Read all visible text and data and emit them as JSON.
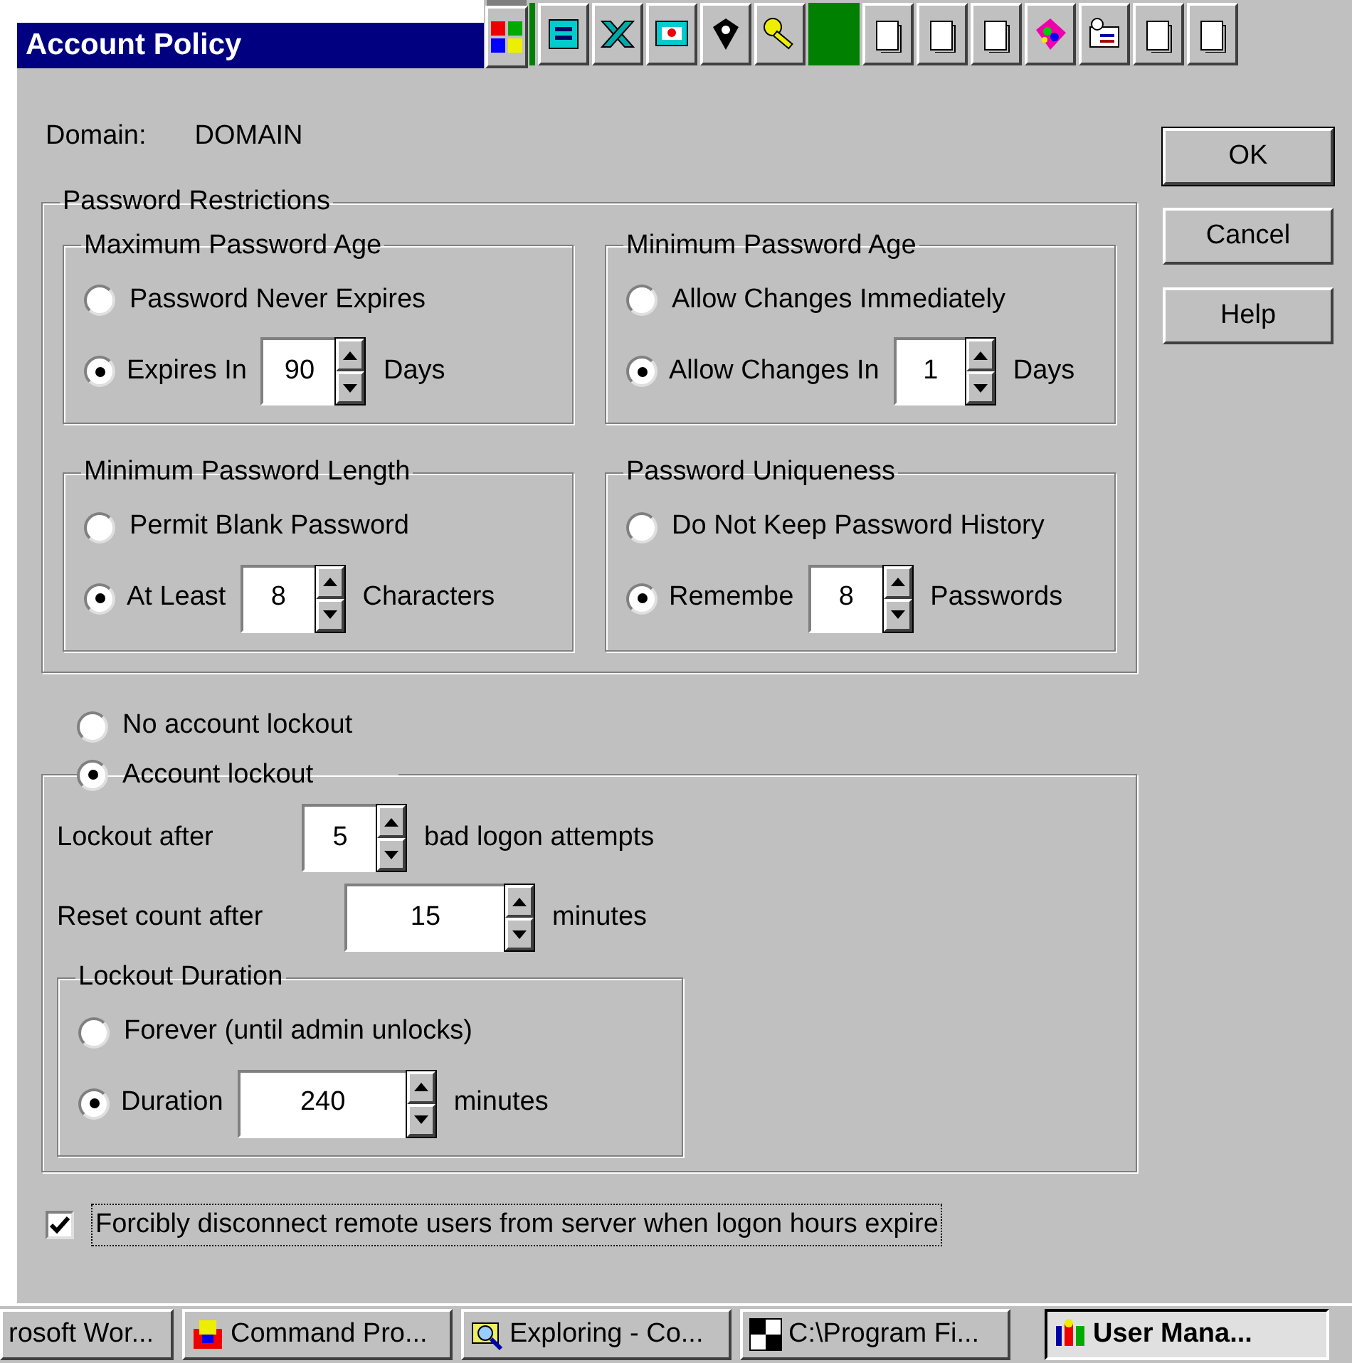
{
  "window": {
    "title": "Account Policy"
  },
  "domain": {
    "label": "Domain:",
    "value": "DOMAIN"
  },
  "buttons": [
    {
      "label": "OK",
      "default": true
    },
    {
      "label": "Cancel",
      "default": false
    },
    {
      "label": "Help",
      "default": false
    }
  ],
  "password_restrictions": {
    "title": "Password Restrictions",
    "groups": [
      {
        "title": "Maximum Password Age",
        "options": [
          {
            "kind": "radio",
            "label": "Password Never Expires",
            "selected": false
          },
          {
            "kind": "spin",
            "label": "Expires In",
            "selected": true,
            "value": "90",
            "unit": "Days"
          }
        ]
      },
      {
        "title": "Minimum Password Age",
        "options": [
          {
            "kind": "radio",
            "label": "Allow Changes Immediately",
            "selected": false
          },
          {
            "kind": "spin",
            "label": "Allow Changes In",
            "selected": true,
            "value": "1",
            "unit": "Days"
          }
        ]
      },
      {
        "title": "Minimum Password Length",
        "options": [
          {
            "kind": "radio",
            "label": "Permit Blank Password",
            "selected": false
          },
          {
            "kind": "spin",
            "label": "At Least",
            "selected": true,
            "value": "8",
            "unit": "Characters"
          }
        ]
      },
      {
        "title": "Password Uniqueness",
        "options": [
          {
            "kind": "radio",
            "label": "Do Not Keep Password History",
            "selected": false
          },
          {
            "kind": "spin",
            "label": "Remembe",
            "selected": true,
            "value": "8",
            "unit": "Passwords"
          }
        ]
      }
    ]
  },
  "lockout_modes": [
    {
      "label": "No account lockout",
      "selected": false
    },
    {
      "label": "Account lockout",
      "selected": true
    }
  ],
  "account_lockout": {
    "fields": [
      {
        "label": "Lockout after",
        "value": "5",
        "unit": "bad logon attempts"
      },
      {
        "label": "Reset count after",
        "value": "15",
        "unit": "minutes"
      }
    ],
    "duration": {
      "title": "Lockout Duration",
      "options": [
        {
          "kind": "radio",
          "label": "Forever (until admin unlocks)",
          "selected": false
        },
        {
          "kind": "spin",
          "label": "Duration",
          "selected": true,
          "value": "240",
          "unit": "minutes"
        }
      ]
    }
  },
  "disconnect_option": {
    "label": "Forcibly disconnect remote users from server when logon hours expire",
    "checked": true
  },
  "taskbar": [
    {
      "label": "rosoft Wor...",
      "selected": false
    },
    {
      "label": "Command Pro...",
      "selected": false
    },
    {
      "label": "Exploring - Co...",
      "selected": false
    },
    {
      "label": "C:\\Program Fi...",
      "selected": false
    },
    {
      "label": "User Mana...",
      "selected": true
    }
  ]
}
